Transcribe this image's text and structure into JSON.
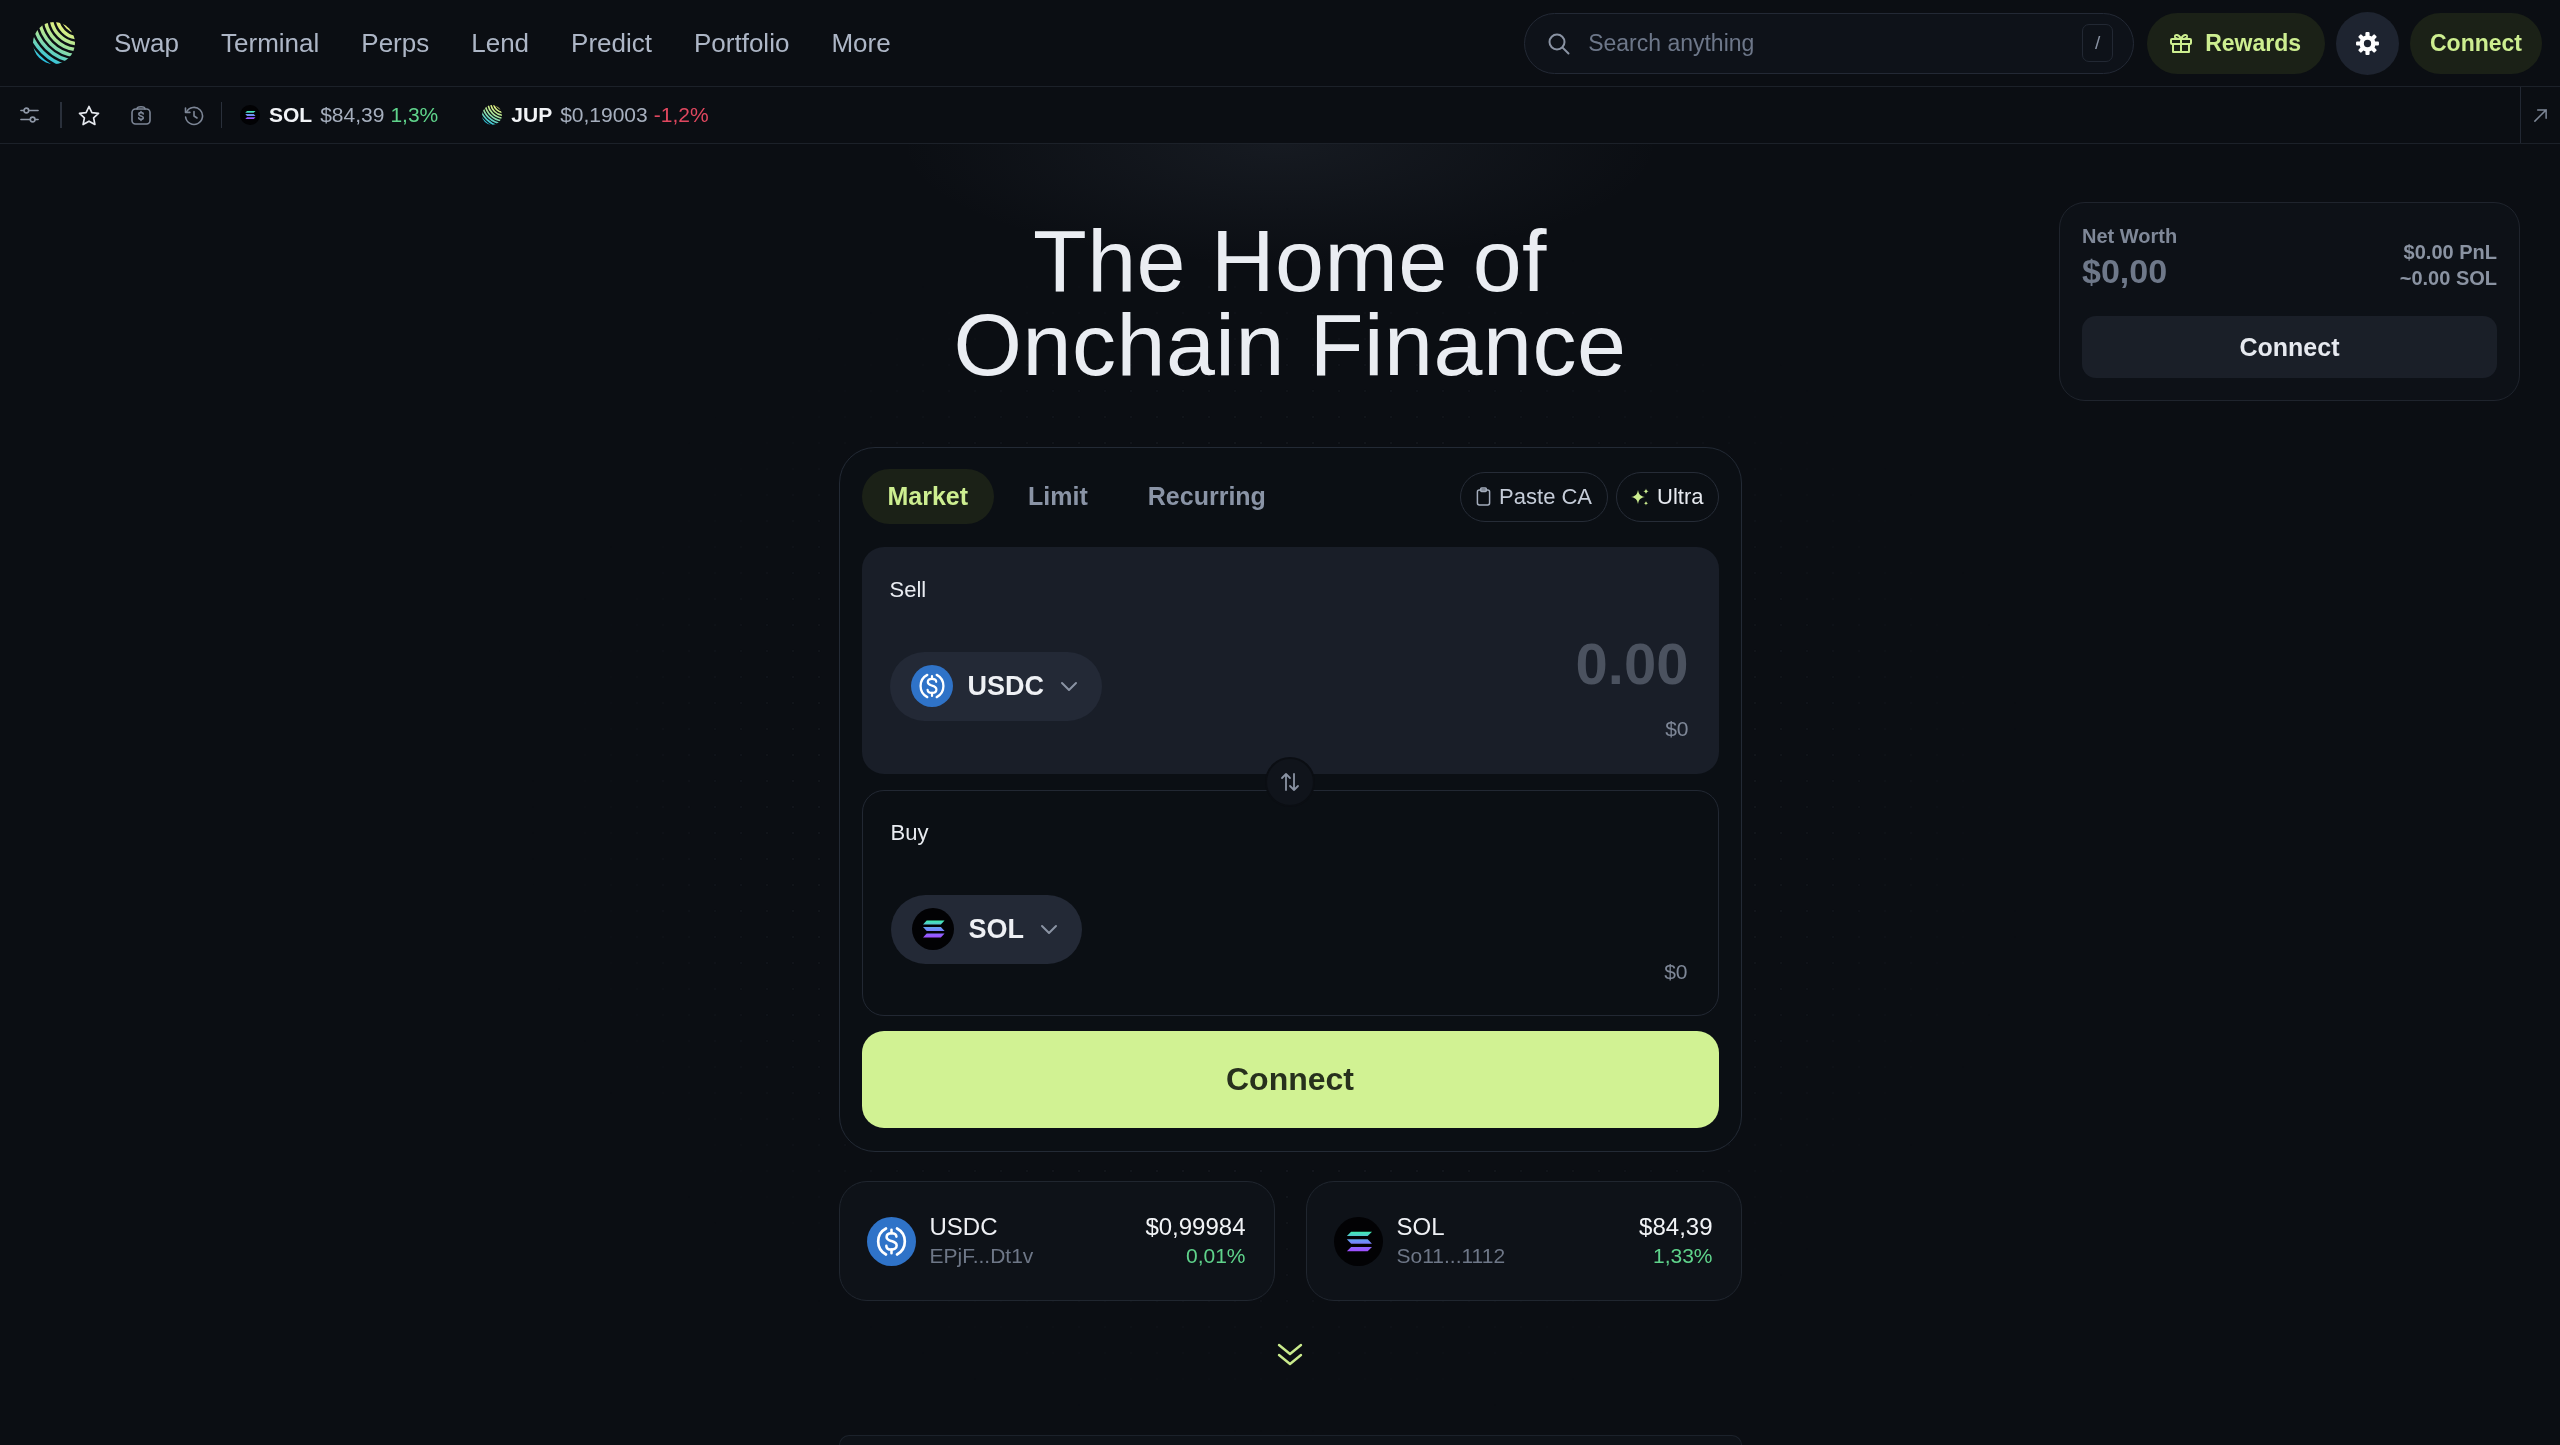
{
  "nav": [
    "Swap",
    "Terminal",
    "Perps",
    "Lend",
    "Predict",
    "Portfolio",
    "More"
  ],
  "search": {
    "placeholder": "Search anything",
    "shortcut": "/"
  },
  "rewards_button": "Rewards",
  "connect_button": "Connect",
  "ticker": [
    {
      "kind": "sol",
      "symbol": "SOL",
      "price": "$84,39",
      "change": "1,3%",
      "color": "#5fd38b"
    },
    {
      "kind": "jup",
      "symbol": "JUP",
      "price": "$0,19003",
      "change": "-1,2%",
      "color": "#e0475f"
    }
  ],
  "hero": {
    "title": [
      "The Home of",
      "Onchain Finance"
    ]
  },
  "swap": {
    "tabs": [
      {
        "label": "Market",
        "selected": true
      },
      {
        "label": "Limit",
        "selected": false
      },
      {
        "label": "Recurring",
        "selected": false
      }
    ],
    "actions": [
      {
        "kind": "paste",
        "label": "Paste CA"
      },
      {
        "kind": "ultra",
        "label": "Ultra"
      }
    ],
    "sell": {
      "label": "Sell",
      "token": {
        "kind": "usdc",
        "symbol": "USDC"
      },
      "placeholder": "0.00",
      "value": "$0"
    },
    "buy": {
      "label": "Buy",
      "token": {
        "kind": "sol",
        "symbol": "SOL"
      },
      "value": "$0"
    },
    "submit_button": "Connect"
  },
  "token_cards": [
    {
      "kind": "usdc",
      "symbol": "USDC",
      "address": "EPjF...Dt1v",
      "price": "$0,99984",
      "change": "0,01%",
      "color": "#5fd38b"
    },
    {
      "kind": "sol",
      "symbol": "SOL",
      "address": "So11...1112",
      "price": "$84,39",
      "change": "1,33%",
      "color": "#5fd38b"
    }
  ],
  "net_worth": {
    "label": "Net Worth",
    "value": "$0,00",
    "pnl": "$0.00 PnL",
    "sol_value": "~0.00 SOL",
    "button": "Connect"
  }
}
